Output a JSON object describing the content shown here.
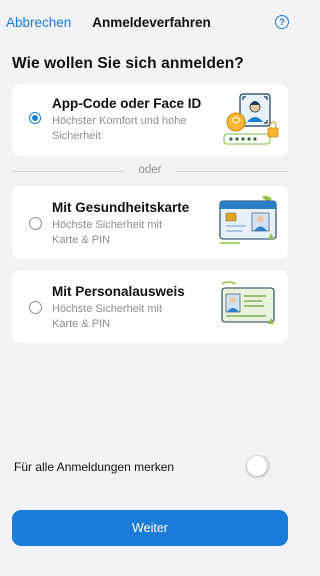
{
  "header": {
    "cancel_label": "Abbrechen",
    "title": "Anmeldeverfahren",
    "help_symbol": "?"
  },
  "question": "Wie wollen Sie sich anmelden?",
  "options": [
    {
      "title": "App-Code oder Face ID",
      "description": "Höchster Komfort und hohe Sicherheit",
      "selected": true,
      "illustration": "face-id-icon"
    },
    {
      "title": "Mit Gesundheitskarte",
      "description": "Höchste Sicherheit mit Karte & PIN",
      "selected": false,
      "illustration": "health-card-icon"
    },
    {
      "title": "Mit Personalausweis",
      "description": "Höchste Sicherheit mit Karte & PIN",
      "selected": false,
      "illustration": "id-card-icon"
    }
  ],
  "divider_label": "oder",
  "remember": {
    "label": "Für alle Anmeldungen merken",
    "enabled": false
  },
  "continue_label": "Weiter",
  "colors": {
    "accent": "#1a7bd9",
    "background": "#f2f2f7"
  }
}
